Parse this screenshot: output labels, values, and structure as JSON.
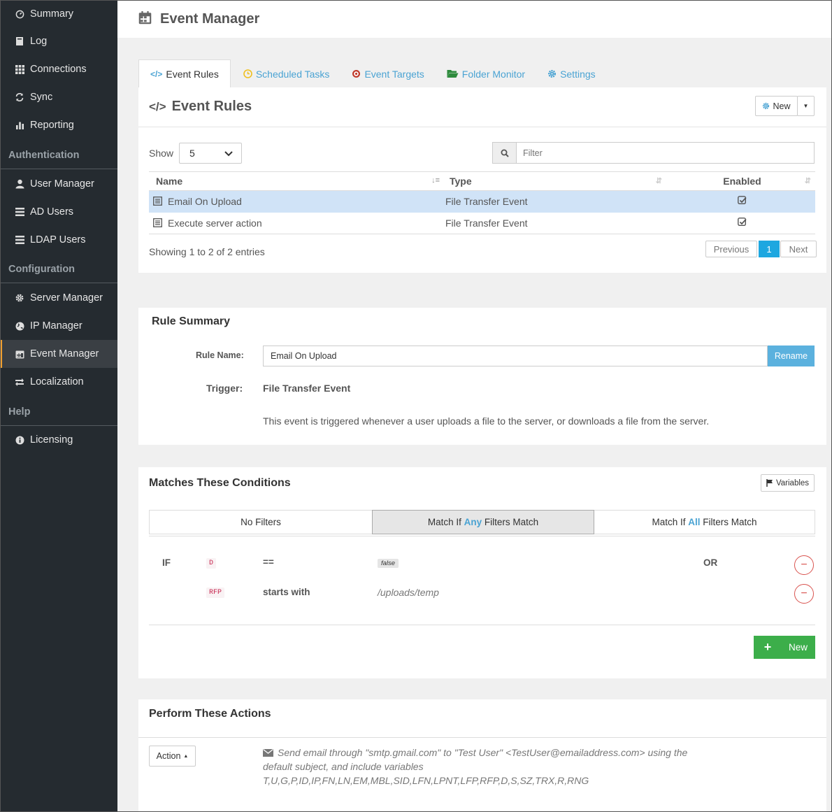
{
  "sidebar": {
    "items_top": [
      {
        "label": "Summary",
        "icon": "dashboard-icon"
      },
      {
        "label": "Log",
        "icon": "log-icon"
      },
      {
        "label": "Connections",
        "icon": "grid-icon"
      },
      {
        "label": "Sync",
        "icon": "sync-icon"
      },
      {
        "label": "Reporting",
        "icon": "bar-chart-icon"
      }
    ],
    "section_auth": "Authentication",
    "items_auth": [
      {
        "label": "User Manager",
        "icon": "user-icon"
      },
      {
        "label": "AD Users",
        "icon": "list-icon"
      },
      {
        "label": "LDAP Users",
        "icon": "list-icon"
      }
    ],
    "section_config": "Configuration",
    "items_config": [
      {
        "label": "Server Manager",
        "icon": "gear-icon"
      },
      {
        "label": "IP Manager",
        "icon": "globe-icon"
      },
      {
        "label": "Event Manager",
        "icon": "calendar-icon",
        "active": true
      },
      {
        "label": "Localization",
        "icon": "exchange-icon"
      }
    ],
    "section_help": "Help",
    "items_help": [
      {
        "label": "Licensing",
        "icon": "info-icon"
      }
    ]
  },
  "header": {
    "title": "Event Manager"
  },
  "tabs": [
    {
      "label": "Event Rules",
      "active": true
    },
    {
      "label": "Scheduled Tasks"
    },
    {
      "label": "Event Targets"
    },
    {
      "label": "Folder Monitor"
    },
    {
      "label": "Settings"
    }
  ],
  "rules_panel": {
    "title": "Event Rules",
    "new_label": "New",
    "show_label": "Show",
    "show_value": "5",
    "filter_placeholder": "Filter",
    "columns": [
      "Name",
      "Type",
      "Enabled"
    ],
    "rows": [
      {
        "name": "Email On Upload",
        "type": "File Transfer Event",
        "enabled": true,
        "selected": true
      },
      {
        "name": "Execute server action",
        "type": "File Transfer Event",
        "enabled": true,
        "selected": false
      }
    ],
    "info": "Showing 1 to 2 of 2 entries",
    "pagination": {
      "previous": "Previous",
      "page": "1",
      "next": "Next"
    }
  },
  "rule_summary": {
    "title": "Rule Summary",
    "rule_name_label": "Rule Name:",
    "rule_name_value": "Email On Upload",
    "rename_label": "Rename",
    "trigger_label": "Trigger:",
    "trigger_value": "File Transfer Event",
    "description": "This event is triggered whenever a user uploads a file to the server, or downloads a file from the server."
  },
  "conditions": {
    "title": "Matches These Conditions",
    "variables_label": "Variables",
    "options": {
      "none": "No Filters",
      "any_pre": "Match If ",
      "any_word": "Any",
      "any_post": " Filters Match",
      "all_pre": "Match If ",
      "all_word": "All",
      "all_post": " Filters Match"
    },
    "if_label": "IF",
    "or_label": "OR",
    "rules": [
      {
        "var": "D",
        "op": "==",
        "value": "false"
      },
      {
        "var": "RFP",
        "op": "starts with",
        "value": "/uploads/temp"
      }
    ],
    "new_label": "New"
  },
  "actions": {
    "title": "Perform These Actions",
    "action_label": "Action",
    "description": "Send email through \"smtp.gmail.com\" to \"Test User\" <TestUser@emailaddress.com> using the default subject, and include variables T,U,G,P,ID,IP,FN,LN,EM,MBL,SID,LFN,LPNT,LFP,RFP,D,S,SZ,TRX,R,RNG"
  },
  "colors": {
    "accent": "#4aa3d3",
    "active_border": "#f0a030",
    "green": "#3cae4a",
    "danger": "#d9534f",
    "page_btn": "#1ea7e0"
  }
}
